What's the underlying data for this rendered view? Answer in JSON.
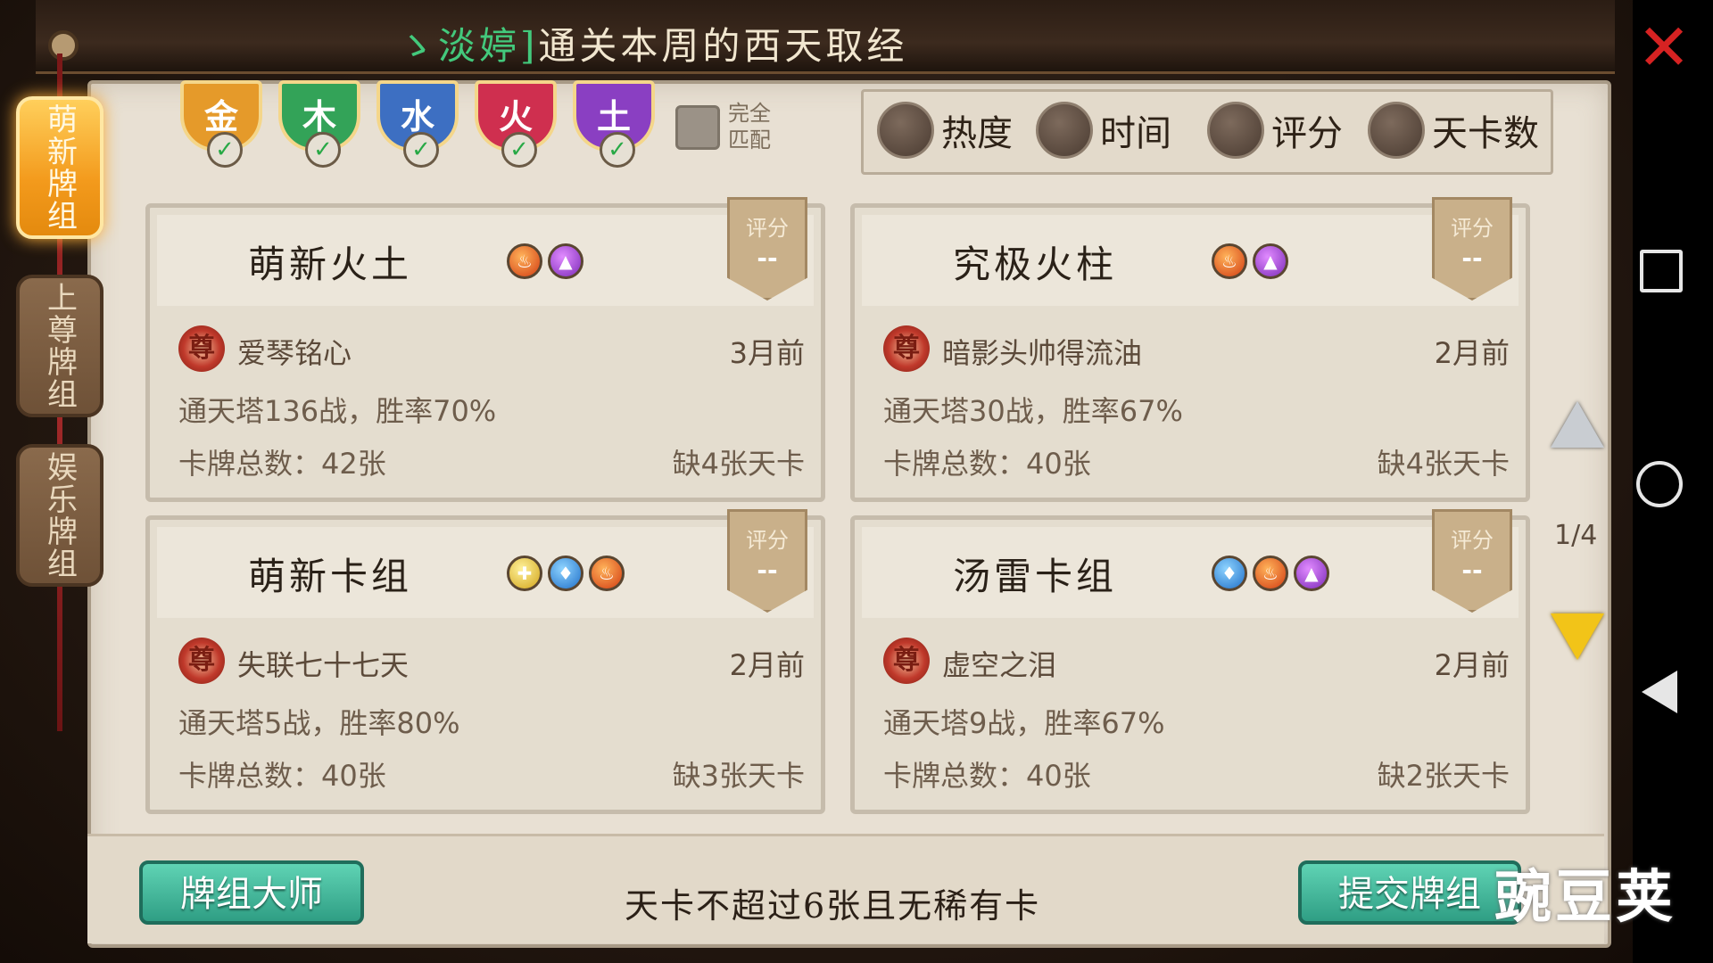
{
  "banner": {
    "prefix": "ゝ淡婷]",
    "message": "通关本周的西天取经"
  },
  "side_tabs": [
    {
      "label": "萌新牌组",
      "active": true
    },
    {
      "label": "上尊牌组",
      "active": false
    },
    {
      "label": "娱乐牌组",
      "active": false
    }
  ],
  "element_filters": [
    {
      "label": "金",
      "color": "#e59a2a",
      "checked": true
    },
    {
      "label": "木",
      "color": "#33a358",
      "checked": true
    },
    {
      "label": "水",
      "color": "#3d6fc2",
      "checked": true
    },
    {
      "label": "火",
      "color": "#cf2f4f",
      "checked": true
    },
    {
      "label": "土",
      "color": "#8a3fc2",
      "checked": true
    }
  ],
  "full_match_label": "完全匹配",
  "sort_options": [
    "热度",
    "时间",
    "评分",
    "天卡数"
  ],
  "decks": [
    {
      "title": "萌新火土",
      "elements": [
        "fire",
        "earth"
      ],
      "score_label": "评分",
      "score": "--",
      "author_badge": "尊",
      "author": "爱琴铭心",
      "time": "3月前",
      "stats": "通天塔136战，胜率70%",
      "total": "卡牌总数：42张",
      "missing": "缺4张天卡"
    },
    {
      "title": "究极火柱",
      "elements": [
        "fire",
        "earth"
      ],
      "score_label": "评分",
      "score": "--",
      "author_badge": "尊",
      "author": "暗影头帅得流油",
      "time": "2月前",
      "stats": "通天塔30战，胜率67%",
      "total": "卡牌总数：40张",
      "missing": "缺4张天卡"
    },
    {
      "title": "萌新卡组",
      "elements": [
        "gold",
        "water",
        "fire"
      ],
      "score_label": "评分",
      "score": "--",
      "author_badge": "尊",
      "author": "失联七十七天",
      "time": "2月前",
      "stats": "通天塔5战，胜率80%",
      "total": "卡牌总数：40张",
      "missing": "缺3张天卡"
    },
    {
      "title": "汤雷卡组",
      "elements": [
        "water",
        "fire",
        "earth"
      ],
      "score_label": "评分",
      "score": "--",
      "author_badge": "尊",
      "author": "虚空之泪",
      "time": "2月前",
      "stats": "通天塔9战，胜率67%",
      "total": "卡牌总数：40张",
      "missing": "缺2张天卡"
    }
  ],
  "pager": {
    "page": "1/4"
  },
  "footer": {
    "master_button": "牌组大师",
    "rule_text": "天卡不超过6张且无稀有卡",
    "submit_button": "提交牌组"
  },
  "watermark": "豌豆荚"
}
